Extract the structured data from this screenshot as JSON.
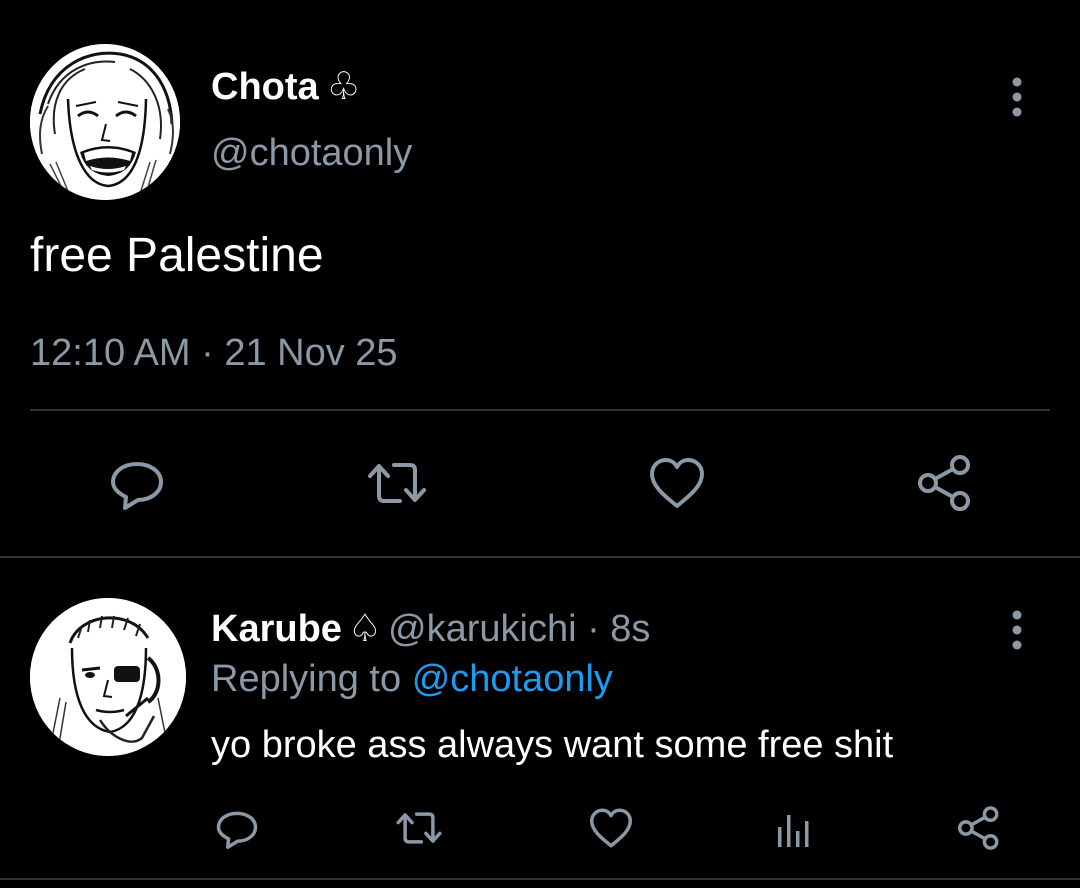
{
  "colors": {
    "background": "#000000",
    "text_primary": "#ffffff",
    "text_secondary": "#8b98a5",
    "link": "#1d9bf0",
    "divider": "#2f3336"
  },
  "main_tweet": {
    "author_name": "Chota",
    "author_suit": "♧",
    "author_handle": "@chotaonly",
    "text": "free Palestine",
    "timestamp": "12:10 AM · 21 Nov 25",
    "more_icon": "more-vertical-icon",
    "actions": [
      {
        "name": "reply",
        "icon": "reply-icon"
      },
      {
        "name": "retweet",
        "icon": "retweet-icon"
      },
      {
        "name": "like",
        "icon": "heart-icon"
      },
      {
        "name": "share",
        "icon": "share-icon"
      }
    ]
  },
  "reply_tweet": {
    "author_name": "Karube",
    "author_suit": "♤",
    "author_handle": "@karukichi",
    "separator": "·",
    "age": "8s",
    "replying_prefix": "Replying to",
    "replying_handle": "@chotaonly",
    "text": "yo broke ass always want some free shit",
    "more_icon": "more-vertical-icon",
    "actions": [
      {
        "name": "reply",
        "icon": "reply-icon"
      },
      {
        "name": "retweet",
        "icon": "retweet-icon"
      },
      {
        "name": "like",
        "icon": "heart-icon"
      },
      {
        "name": "stats",
        "icon": "stats-icon"
      },
      {
        "name": "share",
        "icon": "share-icon"
      }
    ]
  }
}
